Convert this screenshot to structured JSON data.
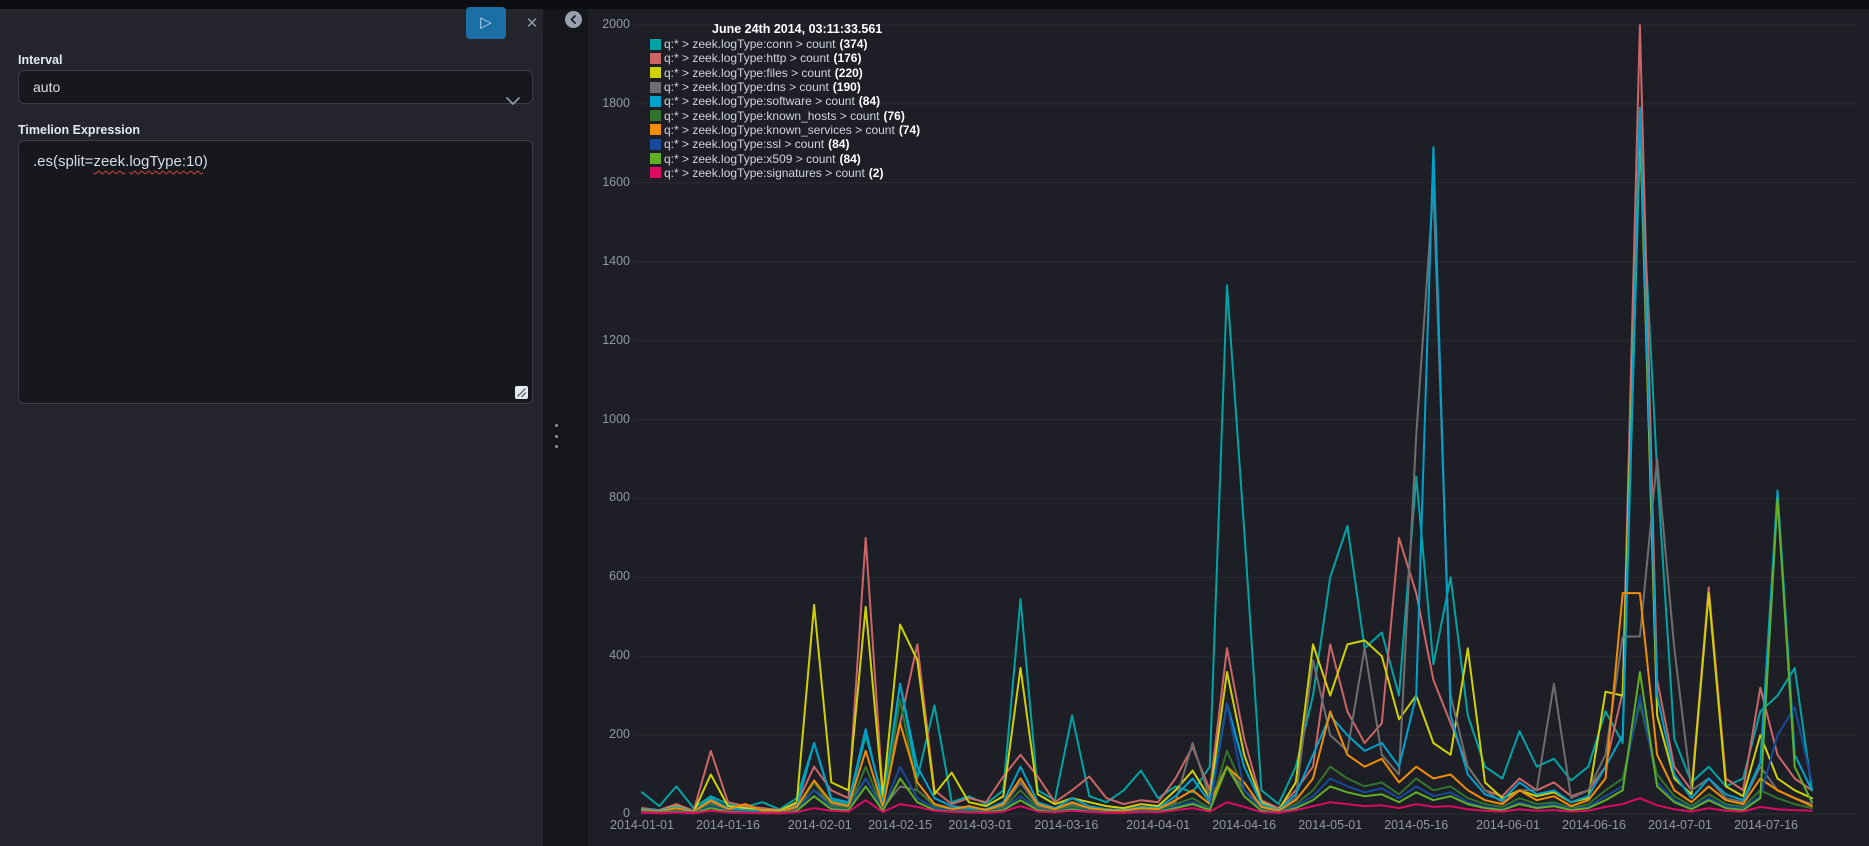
{
  "editor": {
    "play_label": "▷",
    "close_label": "✕",
    "interval_label": "Interval",
    "interval_value": "auto",
    "expression_label": "Timelion Expression",
    "expression": {
      "part1": ".es(split=",
      "part2": "zeek",
      "part3": ".",
      "part4": "logType:10",
      "part5": ")"
    }
  },
  "chart_data": {
    "type": "line",
    "tooltip_title": "June 24th 2014, 03:11:33.561",
    "x_start_date": "2014-01-01",
    "x_step_days": 3,
    "ylim": [
      0,
      2000
    ],
    "grid": true,
    "legend_position": "top-left",
    "y_ticks": [
      0,
      200,
      400,
      600,
      800,
      1000,
      1200,
      1400,
      1600,
      1800,
      2000
    ],
    "x_ticks": [
      {
        "day": 0,
        "label": "2014-01-01"
      },
      {
        "day": 15,
        "label": "2014-01-16"
      },
      {
        "day": 31,
        "label": "2014-02-01"
      },
      {
        "day": 45,
        "label": "2014-02-15"
      },
      {
        "day": 59,
        "label": "2014-03-01"
      },
      {
        "day": 74,
        "label": "2014-03-16"
      },
      {
        "day": 90,
        "label": "2014-04-01"
      },
      {
        "day": 105,
        "label": "2014-04-16"
      },
      {
        "day": 120,
        "label": "2014-05-01"
      },
      {
        "day": 135,
        "label": "2014-05-16"
      },
      {
        "day": 151,
        "label": "2014-06-01"
      },
      {
        "day": 166,
        "label": "2014-06-16"
      },
      {
        "day": 181,
        "label": "2014-07-01"
      },
      {
        "day": 196,
        "label": "2014-07-16"
      }
    ],
    "series": [
      {
        "key": "conn",
        "name": "q:* > zeek.logType:conn > count",
        "count": 374,
        "color": "#01A4A4",
        "values": [
          55,
          20,
          70,
          15,
          45,
          25,
          18,
          30,
          12,
          40,
          180,
          35,
          25,
          200,
          40,
          330,
          90,
          275,
          30,
          45,
          25,
          60,
          545,
          60,
          35,
          250,
          45,
          30,
          60,
          110,
          40,
          70,
          55,
          120,
          1340,
          720,
          60,
          25,
          120,
          300,
          600,
          730,
          420,
          460,
          300,
          855,
          380,
          600,
          250,
          120,
          90,
          210,
          120,
          140,
          85,
          120,
          260,
          180,
          1700,
          870,
          190,
          80,
          120,
          70,
          90,
          260,
          300,
          370,
          60
        ]
      },
      {
        "key": "http",
        "name": "q:* > zeek.logType:http > count",
        "count": 176,
        "color": "#CC6666",
        "values": [
          15,
          10,
          25,
          8,
          160,
          30,
          20,
          15,
          10,
          25,
          120,
          60,
          40,
          700,
          50,
          230,
          430,
          60,
          25,
          40,
          30,
          95,
          150,
          95,
          30,
          60,
          95,
          40,
          25,
          35,
          30,
          90,
          170,
          60,
          420,
          190,
          35,
          15,
          60,
          120,
          430,
          260,
          180,
          230,
          700,
          560,
          340,
          230,
          120,
          60,
          45,
          90,
          60,
          80,
          45,
          60,
          120,
          310,
          2000,
          340,
          120,
          60,
          575,
          90,
          60,
          320,
          150,
          90,
          60
        ]
      },
      {
        "key": "files",
        "name": "q:* > zeek.logType:files > count",
        "count": 220,
        "color": "#D0D102",
        "values": [
          10,
          8,
          20,
          5,
          100,
          20,
          15,
          10,
          8,
          30,
          530,
          80,
          60,
          525,
          45,
          480,
          390,
          50,
          105,
          30,
          20,
          45,
          370,
          50,
          25,
          40,
          30,
          20,
          15,
          25,
          20,
          60,
          110,
          40,
          360,
          150,
          30,
          10,
          80,
          430,
          300,
          430,
          440,
          400,
          240,
          300,
          180,
          150,
          420,
          80,
          40,
          60,
          45,
          55,
          30,
          40,
          310,
          300,
          1760,
          250,
          90,
          50,
          560,
          70,
          45,
          200,
          90,
          60,
          40
        ]
      },
      {
        "key": "dns",
        "name": "q:* > zeek.logType:dns > count",
        "count": 190,
        "color": "#6E6E6E",
        "values": [
          8,
          5,
          12,
          4,
          30,
          10,
          8,
          6,
          5,
          15,
          60,
          25,
          20,
          90,
          15,
          70,
          60,
          25,
          15,
          10,
          8,
          20,
          80,
          20,
          12,
          25,
          15,
          10,
          8,
          12,
          10,
          30,
          180,
          40,
          120,
          60,
          20,
          8,
          40,
          390,
          200,
          160,
          420,
          150,
          100,
          960,
          1590,
          300,
          120,
          60,
          30,
          60,
          60,
          330,
          40,
          60,
          150,
          450,
          450,
          900,
          420,
          60,
          90,
          40,
          30,
          120,
          60,
          40,
          25
        ]
      },
      {
        "key": "software",
        "name": "q:* > zeek.logType:software > count",
        "count": 84,
        "color": "#00A1CB",
        "values": [
          12,
          8,
          18,
          6,
          40,
          15,
          10,
          8,
          6,
          20,
          180,
          40,
          30,
          215,
          25,
          330,
          120,
          40,
          20,
          15,
          12,
          30,
          120,
          30,
          15,
          40,
          20,
          12,
          10,
          18,
          15,
          45,
          90,
          30,
          280,
          120,
          25,
          10,
          50,
          150,
          250,
          200,
          160,
          180,
          120,
          300,
          1690,
          250,
          100,
          50,
          35,
          80,
          50,
          60,
          30,
          45,
          120,
          200,
          1790,
          300,
          100,
          40,
          90,
          50,
          35,
          130,
          820,
          150,
          60
        ]
      },
      {
        "key": "known_hosts",
        "name": "q:* > zeek.logType:known_hosts > count",
        "count": 76,
        "color": "#32742C",
        "values": [
          5,
          4,
          10,
          3,
          25,
          8,
          6,
          5,
          4,
          12,
          80,
          20,
          15,
          120,
          12,
          290,
          60,
          20,
          10,
          8,
          6,
          15,
          60,
          15,
          8,
          20,
          10,
          6,
          5,
          10,
          8,
          25,
          40,
          15,
          160,
          60,
          12,
          5,
          25,
          60,
          120,
          90,
          70,
          80,
          50,
          90,
          60,
          70,
          40,
          25,
          18,
          40,
          25,
          30,
          15,
          25,
          60,
          90,
          280,
          100,
          45,
          20,
          50,
          25,
          18,
          60,
          40,
          25,
          15
        ]
      },
      {
        "key": "known_services",
        "name": "q:* > zeek.logType:known_services > count",
        "count": 74,
        "color": "#F18D05",
        "values": [
          10,
          6,
          15,
          5,
          35,
          12,
          25,
          8,
          6,
          18,
          85,
          30,
          20,
          160,
          18,
          230,
          80,
          25,
          12,
          20,
          10,
          25,
          90,
          25,
          12,
          30,
          15,
          10,
          8,
          15,
          12,
          35,
          60,
          25,
          120,
          80,
          18,
          8,
          35,
          90,
          260,
          150,
          120,
          140,
          80,
          120,
          90,
          100,
          60,
          35,
          25,
          60,
          35,
          45,
          20,
          35,
          90,
          560,
          560,
          150,
          60,
          30,
          70,
          35,
          25,
          90,
          60,
          40,
          20
        ]
      },
      {
        "key": "ssl",
        "name": "q:* > zeek.logType:ssl > count",
        "count": 84,
        "color": "#164A9C",
        "values": [
          6,
          4,
          8,
          3,
          20,
          8,
          5,
          4,
          3,
          10,
          60,
          15,
          12,
          90,
          10,
          120,
          40,
          15,
          8,
          6,
          5,
          12,
          45,
          12,
          6,
          15,
          8,
          5,
          4,
          8,
          6,
          20,
          30,
          12,
          280,
          60,
          10,
          4,
          20,
          45,
          90,
          70,
          55,
          65,
          40,
          70,
          45,
          55,
          30,
          18,
          12,
          30,
          18,
          25,
          12,
          18,
          45,
          70,
          300,
          80,
          35,
          15,
          40,
          20,
          14,
          45,
          200,
          270,
          80
        ]
      },
      {
        "key": "x509",
        "name": "q:* > zeek.logType:x509 > count",
        "count": 84,
        "color": "#61AE24",
        "values": [
          4,
          3,
          6,
          2,
          15,
          6,
          4,
          3,
          2,
          8,
          45,
          12,
          10,
          70,
          8,
          90,
          30,
          10,
          6,
          5,
          4,
          10,
          35,
          10,
          5,
          12,
          6,
          4,
          3,
          6,
          5,
          15,
          25,
          10,
          120,
          45,
          8,
          3,
          15,
          35,
          70,
          55,
          45,
          50,
          30,
          55,
          35,
          45,
          25,
          15,
          10,
          25,
          15,
          20,
          10,
          15,
          35,
          60,
          360,
          70,
          30,
          12,
          35,
          15,
          10,
          40,
          800,
          120,
          30
        ]
      },
      {
        "key": "signatures",
        "name": "q:* > zeek.logType:signatures > count",
        "count": 2,
        "color": "#DB0B64",
        "values": [
          3,
          2,
          4,
          2,
          8,
          4,
          3,
          2,
          2,
          5,
          15,
          8,
          6,
          35,
          5,
          25,
          18,
          8,
          5,
          4,
          3,
          6,
          20,
          6,
          4,
          8,
          5,
          3,
          3,
          5,
          4,
          10,
          15,
          6,
          30,
          18,
          5,
          3,
          10,
          20,
          30,
          25,
          20,
          22,
          15,
          25,
          18,
          20,
          12,
          8,
          6,
          12,
          8,
          10,
          6,
          8,
          18,
          25,
          40,
          22,
          12,
          6,
          15,
          8,
          6,
          18,
          12,
          10,
          8
        ]
      }
    ]
  }
}
